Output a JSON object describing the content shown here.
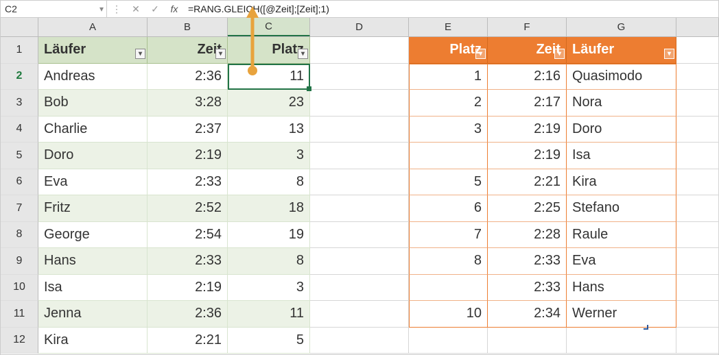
{
  "formula_bar": {
    "cell_ref": "C2",
    "formula": "=RANG.GLEICH([@Zeit];[Zeit];1)"
  },
  "columns": [
    "A",
    "B",
    "C",
    "D",
    "E",
    "F",
    "G"
  ],
  "active_column_index": 2,
  "row_headers": [
    "1",
    "2",
    "3",
    "4",
    "5",
    "6",
    "7",
    "8",
    "9",
    "10",
    "11",
    "12"
  ],
  "active_row_index": 1,
  "left_table": {
    "headers": [
      "Läufer",
      "Zeit",
      "Platz"
    ],
    "rows": [
      {
        "a": "Andreas",
        "b": "2:36",
        "c": "11"
      },
      {
        "a": "Bob",
        "b": "3:28",
        "c": "23"
      },
      {
        "a": "Charlie",
        "b": "2:37",
        "c": "13"
      },
      {
        "a": "Doro",
        "b": "2:19",
        "c": "3"
      },
      {
        "a": "Eva",
        "b": "2:33",
        "c": "8"
      },
      {
        "a": "Fritz",
        "b": "2:52",
        "c": "18"
      },
      {
        "a": "George",
        "b": "2:54",
        "c": "19"
      },
      {
        "a": "Hans",
        "b": "2:33",
        "c": "8"
      },
      {
        "a": "Isa",
        "b": "2:19",
        "c": "3"
      },
      {
        "a": "Jenna",
        "b": "2:36",
        "c": "11"
      },
      {
        "a": "Kira",
        "b": "2:21",
        "c": "5"
      }
    ]
  },
  "right_table": {
    "headers": [
      "Platz",
      "Zeit",
      "Läufer"
    ],
    "rows": [
      {
        "e": "1",
        "f": "2:16",
        "g": "Quasimodo"
      },
      {
        "e": "2",
        "f": "2:17",
        "g": "Nora"
      },
      {
        "e": "3",
        "f": "2:19",
        "g": "Doro"
      },
      {
        "e": "",
        "f": "2:19",
        "g": "Isa"
      },
      {
        "e": "5",
        "f": "2:21",
        "g": "Kira"
      },
      {
        "e": "6",
        "f": "2:25",
        "g": "Stefano"
      },
      {
        "e": "7",
        "f": "2:28",
        "g": "Raule"
      },
      {
        "e": "8",
        "f": "2:33",
        "g": "Eva"
      },
      {
        "e": "",
        "f": "2:33",
        "g": "Hans"
      },
      {
        "e": "10",
        "f": "2:34",
        "g": "Werner"
      }
    ]
  }
}
